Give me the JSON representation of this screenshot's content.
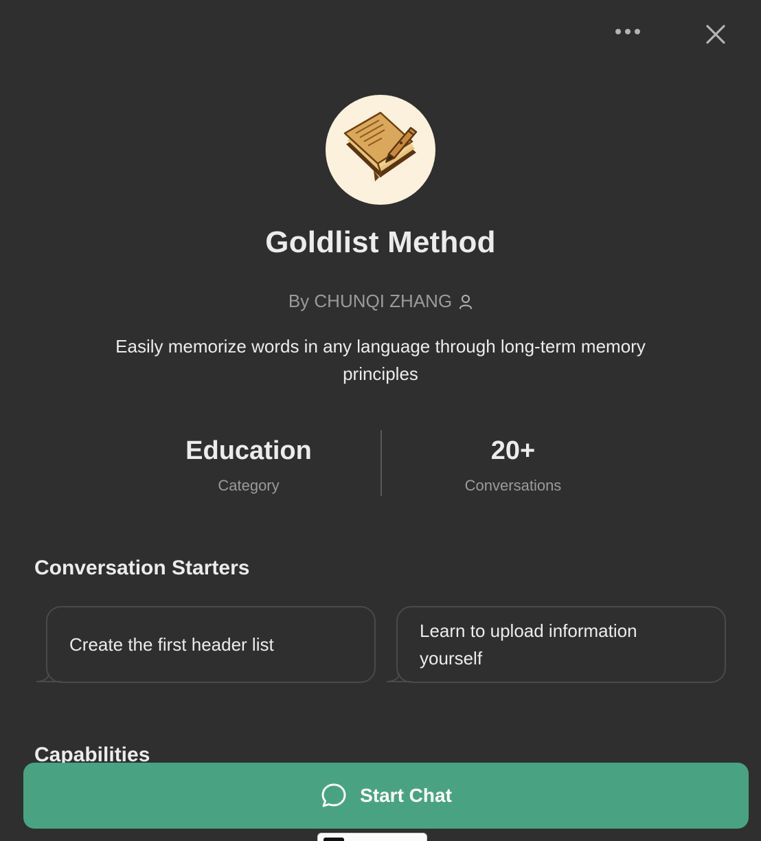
{
  "header": {
    "more_icon": "ellipsis-icon",
    "close_icon": "close-icon"
  },
  "gpt": {
    "title": "Goldlist Method",
    "author": "By CHUNQI ZHANG",
    "author_icon": "person-icon",
    "description": "Easily memorize words in any language through long-term memory principles",
    "avatar_icon": "notebook-pen-icon"
  },
  "stats": [
    {
      "value": "Education",
      "label": "Category"
    },
    {
      "value": "20+",
      "label": "Conversations"
    }
  ],
  "starters": {
    "title": "Conversation Starters",
    "items": [
      "Create the first header list",
      "Learn to upload information yourself"
    ]
  },
  "capabilities": {
    "title": "Capabilities"
  },
  "cta": {
    "label": "Start Chat",
    "icon": "chat-bubble-icon"
  },
  "colors": {
    "background": "#2f2f2f",
    "accent": "#49a383",
    "muted_text": "#9b9b9b",
    "text": "#ececec"
  }
}
